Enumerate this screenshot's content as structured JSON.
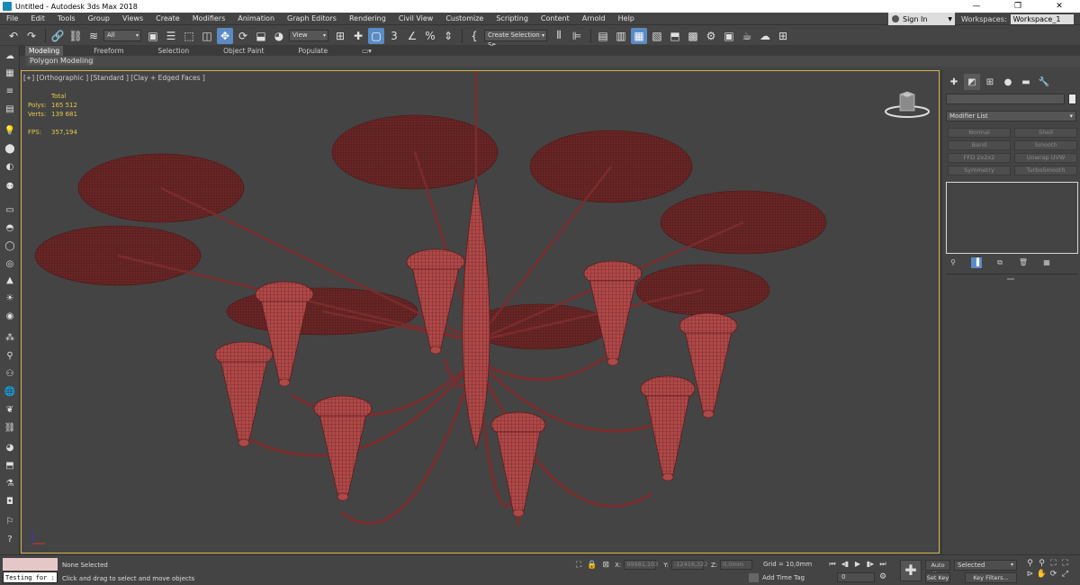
{
  "window": {
    "title": "Untitled - Autodesk 3ds Max 2018",
    "minimize": "—",
    "restore": "❐",
    "close": "✕"
  },
  "menu": [
    "File",
    "Edit",
    "Tools",
    "Group",
    "Views",
    "Create",
    "Modifiers",
    "Animation",
    "Graph Editors",
    "Rendering",
    "Civil View",
    "Customize",
    "Scripting",
    "Content",
    "Arnold",
    "Help"
  ],
  "account": {
    "signin_label": "Sign In"
  },
  "workspaces": {
    "label": "Workspaces:",
    "current": "Workspace_1"
  },
  "toolbar": {
    "selection_filter": "All",
    "ref_coord": "View",
    "snap_label": "3",
    "named_selection": "Create Selection Se"
  },
  "ribbon": {
    "tabs": [
      "Modeling",
      "Freeform",
      "Selection",
      "Object Paint",
      "Populate"
    ],
    "active_tab": "Modeling",
    "panel_label": "Polygon Modeling"
  },
  "viewport": {
    "label": "[+] [Orthographic ] [Standard ] [Clay + Edged Faces ]",
    "stats": {
      "header": "Total",
      "polys_label": "Polys:",
      "polys": "165 512",
      "verts_label": "Verts:",
      "verts": "139 681",
      "fps_label": "FPS:",
      "fps": "357,194"
    },
    "mesh_color": "#b04848",
    "viewcube_label": "TOP"
  },
  "command_panel": {
    "modifier_list": "Modifier List",
    "buttons": [
      "Normal",
      "Shell",
      "Bend",
      "Smooth",
      "FFD 2x2x2",
      "Unwrap UVW",
      "Symmetry",
      "TurboSmooth"
    ]
  },
  "status": {
    "maxscript_input": "Testing for :",
    "selection": "None Selected",
    "prompt": "Click and drag to select and move objects",
    "x_label": "X:",
    "x_value": "99981,103",
    "y_label": "Y:",
    "y_value": "-12416,322",
    "z_label": "Z:",
    "z_value": "0,0mm",
    "grid": "Grid = 10,0mm",
    "add_time_tag": "Add Time Tag",
    "frame": "0",
    "auto_key": "Auto Key",
    "set_key": "Set Key",
    "key_selection": "Selected",
    "key_filters": "Key Filters..."
  }
}
